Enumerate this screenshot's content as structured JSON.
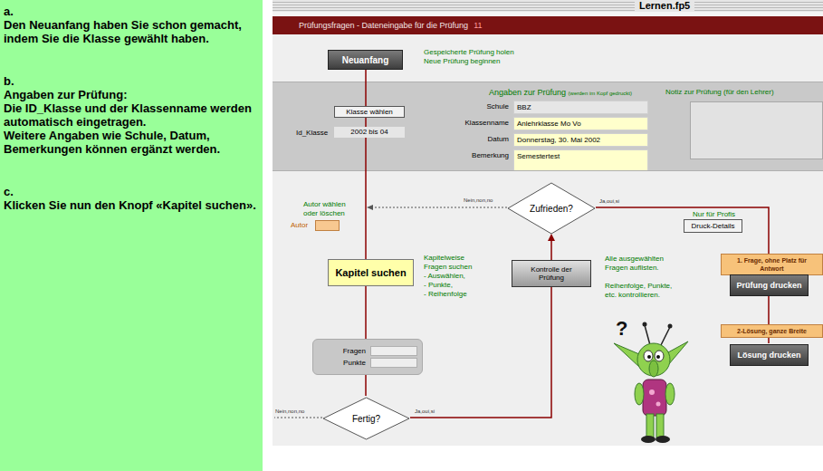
{
  "instructions": [
    {
      "step": "a.",
      "lines": [
        "Den Neuanfang haben Sie schon gemacht, indem Sie die Klasse gewählt haben."
      ]
    },
    {
      "step": "b.",
      "lines": [
        "Angaben zur Prüfung:",
        "Die ID_Klasse und der Klassenname werden automatisch eingetragen.",
        "Weitere Angaben wie Schule, Datum, Bemerkungen können ergänzt werden."
      ]
    },
    {
      "step": "c.",
      "lines": [
        "Klicken Sie nun den Knopf  «Kapitel suchen»."
      ]
    }
  ],
  "window": {
    "title": "Lernen.fp5"
  },
  "header": {
    "title": "Prüfungsfragen - Dateneingabe für die Prüfung",
    "number": "11"
  },
  "neuanfang": {
    "button": "Neuanfang",
    "notes": [
      "Gespeicherte Prüfung holen",
      "Neue Prüfung beginnen"
    ]
  },
  "klasse": {
    "button": "Klasse wählen",
    "id_label": "Id_Klasse",
    "id_value": "2002 bis 04"
  },
  "angaben": {
    "title": "Angaben zur Prüfung",
    "subtitle": "(werden im Kopf gedruckt)",
    "fields": [
      {
        "label": "Schule",
        "value": "BBZ",
        "highlighted": false,
        "tall": false
      },
      {
        "label": "Klassenname",
        "value": "Anlehrklasse Mo Vo",
        "highlighted": true,
        "tall": false
      },
      {
        "label": "Datum",
        "value": "Donnerstag, 30. Mai 2002",
        "highlighted": true,
        "tall": false
      },
      {
        "label": "Bemerkung",
        "value": "Semestertest",
        "highlighted": true,
        "tall": true
      }
    ]
  },
  "notiz": {
    "title": "Notiz zur Prüfung (für den Lehrer)"
  },
  "flow": {
    "zufrieden": {
      "question": "Zufrieden?",
      "no": "Nein,non,no",
      "yes": "Ja,oui,si"
    },
    "fertig": {
      "question": "Fertig?",
      "no": "Nein,non,no",
      "yes": "Ja,oui,si"
    },
    "autor": {
      "hint": "Autor wählen oder löschen",
      "label": "Autor"
    },
    "kapitel": {
      "button": "Kapitel suchen",
      "notes": [
        "Kapitelweise",
        "Fragen suchen",
        "- Auswählen,",
        "- Punkte,",
        "- Reihenfolge"
      ]
    },
    "kontrolle": {
      "button": "Kontrolle der Prüfung",
      "notes": [
        "Alle ausgewählten",
        "Fragen auflisten.",
        "",
        "Reihenfolge, Punkte,",
        "etc. kontrollieren."
      ]
    },
    "counters": [
      {
        "label": "Fragen"
      },
      {
        "label": "Punkte"
      }
    ],
    "druck": {
      "hint": "Nur für Profis",
      "button": "Druck-Details"
    },
    "print": [
      {
        "option": "1. Frage, ohne Platz für Antwort",
        "button": "Prüfung drucken"
      },
      {
        "option": "2-Lösung, ganze Breite",
        "button": "Lösung drucken"
      }
    ]
  },
  "mascot": {
    "thought": "?"
  }
}
